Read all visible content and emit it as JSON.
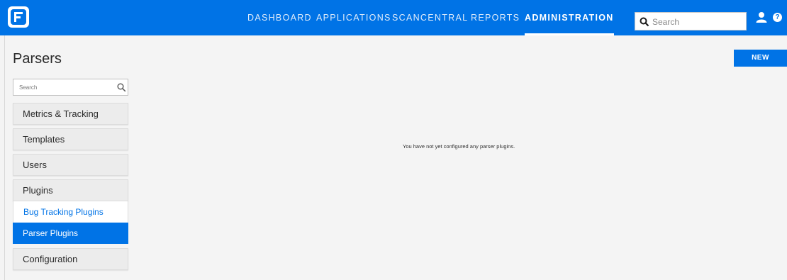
{
  "header": {
    "logo_icon": "fortify-logo-icon",
    "nav": [
      {
        "label": "DASHBOARD"
      },
      {
        "label": "APPLICATIONS"
      },
      {
        "label": "SCANCENTRAL"
      },
      {
        "label": "REPORTS"
      },
      {
        "label": "ADMINISTRATION"
      }
    ],
    "active_nav": "ADMINISTRATION",
    "search_placeholder": "Search",
    "user_icon": "user-icon",
    "help_icon": "help-icon",
    "help_glyph": "?"
  },
  "page": {
    "title": "Parsers",
    "new_label": "NEW",
    "empty_message": "You have not yet configured any parser plugins."
  },
  "sidebar": {
    "search_placeholder": "Search",
    "items": [
      {
        "label": "Metrics & Tracking"
      },
      {
        "label": "Templates"
      },
      {
        "label": "Users"
      },
      {
        "label": "Plugins"
      }
    ],
    "subitems": [
      {
        "label": "Bug Tracking Plugins"
      },
      {
        "label": "Parser Plugins",
        "selected": true
      }
    ],
    "after_items": [
      {
        "label": "Configuration"
      }
    ]
  },
  "colors": {
    "brand_blue": "#0073e6",
    "background": "#f4f4f4"
  }
}
